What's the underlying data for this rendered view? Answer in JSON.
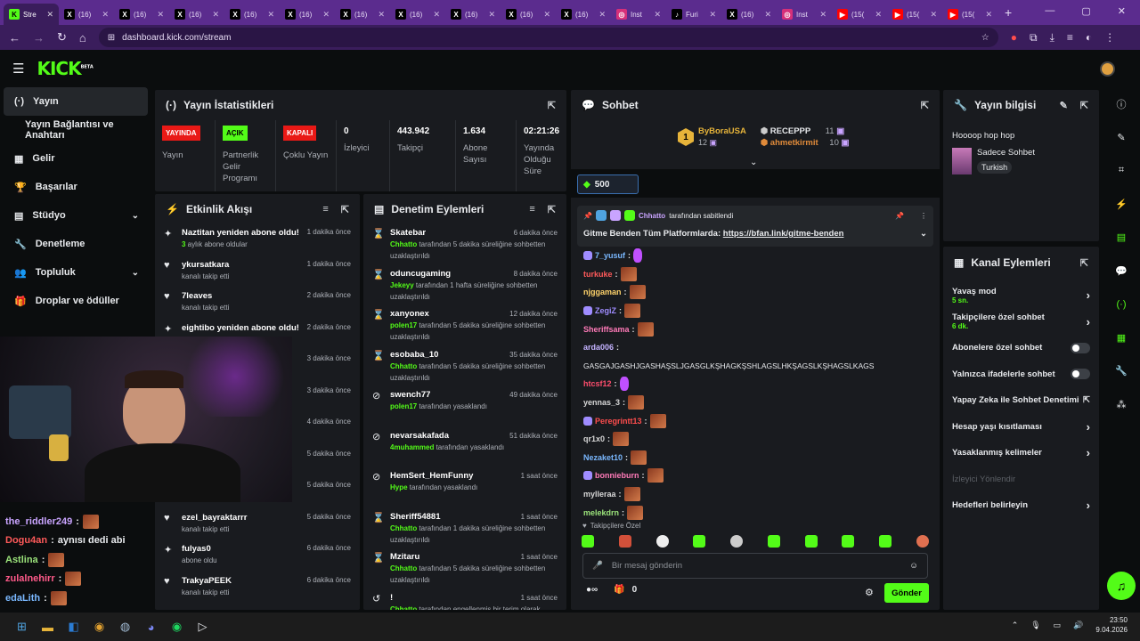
{
  "browser": {
    "tabs": [
      {
        "label": "Stre",
        "fav": "K",
        "color": "#53fc18",
        "active": true
      },
      {
        "label": "(16)",
        "fav": "X",
        "color": "#000000"
      },
      {
        "label": "(16)",
        "fav": "X",
        "color": "#000000"
      },
      {
        "label": "(16)",
        "fav": "X",
        "color": "#000000"
      },
      {
        "label": "(16)",
        "fav": "X",
        "color": "#000000"
      },
      {
        "label": "(16)",
        "fav": "X",
        "color": "#000000"
      },
      {
        "label": "(16)",
        "fav": "X",
        "color": "#000000"
      },
      {
        "label": "(16)",
        "fav": "X",
        "color": "#000000"
      },
      {
        "label": "(16)",
        "fav": "X",
        "color": "#000000"
      },
      {
        "label": "(16)",
        "fav": "X",
        "color": "#000000"
      },
      {
        "label": "(16)",
        "fav": "X",
        "color": "#000000"
      },
      {
        "label": "Inst",
        "fav": "◎",
        "color": "#d6307a"
      },
      {
        "label": "Furi",
        "fav": "♪",
        "color": "#000000"
      },
      {
        "label": "(16)",
        "fav": "X",
        "color": "#000000"
      },
      {
        "label": "Inst",
        "fav": "◎",
        "color": "#d6307a"
      },
      {
        "label": "(15(",
        "fav": "▶",
        "color": "#ff0000"
      },
      {
        "label": "(15(",
        "fav": "▶",
        "color": "#ff0000"
      },
      {
        "label": "(15(",
        "fav": "▶",
        "color": "#ff0000"
      }
    ],
    "url": "dashboard.kick.com/stream"
  },
  "sidebar": {
    "items": [
      {
        "label": "Yayın",
        "icon": "broadcast-icon",
        "glyph": "(·)"
      },
      {
        "label": "Yayın Bağlantısı ve Anahtarı"
      },
      {
        "label": "Gelir",
        "icon": "revenue-icon",
        "glyph": "▦"
      },
      {
        "label": "Başarılar",
        "icon": "trophy-icon",
        "glyph": "🏆"
      },
      {
        "label": "Stüdyo",
        "icon": "studio-icon",
        "glyph": "▤",
        "chev": "⌄"
      },
      {
        "label": "Denetleme",
        "icon": "wrench-icon",
        "glyph": "🔧"
      },
      {
        "label": "Topluluk",
        "icon": "community-icon",
        "glyph": "👥",
        "chev": "⌄"
      },
      {
        "label": "Droplar ve ödüller",
        "icon": "gift-icon",
        "glyph": "🎁"
      }
    ]
  },
  "stats": {
    "title": "Yayın İstatistikleri",
    "cols": [
      {
        "badge": "YAYINDA",
        "badge_color": "#e91916",
        "label": "Yayın"
      },
      {
        "badge": "AÇIK",
        "badge_color": "#53fc18",
        "label": "Partnerlik Gelir Programı"
      },
      {
        "badge": "KAPALI",
        "badge_color": "#e91916",
        "label": "Çoklu Yayın"
      },
      {
        "value": "0",
        "label": "İzleyici"
      },
      {
        "value": "443.942",
        "label": "Takipçi"
      },
      {
        "value": "1.634",
        "label": "Abone Sayısı"
      },
      {
        "value": "02:21:26",
        "label": "Yayında Olduğu Süre"
      }
    ]
  },
  "activity": {
    "title": "Etkinlik Akışı",
    "items": [
      {
        "icon": "sparkle-icon",
        "glyph": "✦",
        "name": "Naztitan yeniden abone oldu!",
        "sub_green": "3",
        "sub": " aylık abone oldular",
        "time": "1 dakika önce"
      },
      {
        "icon": "heart-icon",
        "glyph": "♥",
        "name": "ykursatkara",
        "sub": "kanalı takip etti",
        "time": "1 dakika önce"
      },
      {
        "icon": "heart-icon",
        "glyph": "♥",
        "name": "7leaves",
        "sub": "kanalı takip etti",
        "time": "2 dakika önce"
      },
      {
        "icon": "sparkle-icon",
        "glyph": "✦",
        "name": "eightibo yeniden abone oldu!",
        "sub": "",
        "time": "2 dakika önce"
      },
      {
        "icon": "heart-icon",
        "glyph": "♥",
        "name": "",
        "sub": "",
        "time": "3 dakika önce"
      },
      {
        "icon": "heart-icon",
        "glyph": "♥",
        "name": "",
        "sub": "",
        "time": "3 dakika önce"
      },
      {
        "icon": "heart-icon",
        "glyph": "♥",
        "name": "",
        "sub": "",
        "time": "4 dakika önce"
      },
      {
        "icon": "heart-icon",
        "glyph": "♥",
        "name": "",
        "sub": "",
        "time": "5 dakika önce"
      },
      {
        "icon": "heart-icon",
        "glyph": "♥",
        "name": "",
        "sub": "kanalı takip etti",
        "time": "5 dakika önce"
      },
      {
        "icon": "heart-icon",
        "glyph": "♥",
        "name": "ezel_bayraktarrr",
        "sub": "kanalı takip etti",
        "time": "5 dakika önce"
      },
      {
        "icon": "star-icon",
        "glyph": "✦",
        "name": "fulyas0",
        "sub": "abone oldu",
        "time": "6 dakika önce"
      },
      {
        "icon": "heart-icon",
        "glyph": "♥",
        "name": "TrakyaPEEK",
        "sub": "kanalı takip etti",
        "time": "6 dakika önce"
      }
    ]
  },
  "moderation": {
    "title": "Denetim Eylemleri",
    "items": [
      {
        "icon": "hourglass-icon",
        "glyph": "⌛",
        "name": "Skatebar",
        "actor": "Chhatto",
        "text": " tarafından 5 dakika süreliğine sohbetten uzaklaştırıldı",
        "time": "6 dakika önce"
      },
      {
        "icon": "hourglass-icon",
        "glyph": "⌛",
        "name": "oduncugaming",
        "actor": "Jekeyy",
        "text": " tarafından 1 hafta süreliğine sohbetten uzaklaştırıldı",
        "time": "8 dakika önce"
      },
      {
        "icon": "hourglass-icon",
        "glyph": "⌛",
        "name": "xanyonex",
        "actor": "polen17",
        "text": " tarafından 5 dakika süreliğine sohbetten uzaklaştırıldı",
        "time": "12 dakika önce"
      },
      {
        "icon": "hourglass-icon",
        "glyph": "⌛",
        "name": "esobaba_10",
        "actor": "Chhatto",
        "text": " tarafından 5 dakika süreliğine sohbetten uzaklaştırıldı",
        "time": "35 dakika önce"
      },
      {
        "icon": "ban-icon",
        "glyph": "⊘",
        "name": "swench77",
        "actor": "polen17",
        "text": " tarafından yasaklandı",
        "time": "49 dakika önce"
      },
      {
        "icon": "ban-icon",
        "glyph": "⊘",
        "name": "nevarsakafada",
        "actor": "4muhammed",
        "text": " tarafından yasaklandı",
        "time": "51 dakika önce"
      },
      {
        "icon": "ban-icon",
        "glyph": "⊘",
        "name": "HemSert_HemFunny",
        "actor": "Hype",
        "text": " tarafından yasaklandı",
        "time": "1 saat önce"
      },
      {
        "icon": "hourglass-icon",
        "glyph": "⌛",
        "name": "Sheriff54881",
        "actor": "Chhatto",
        "text": " tarafından 1 dakika süreliğine sohbetten uzaklaştırıldı",
        "time": "1 saat önce"
      },
      {
        "icon": "hourglass-icon",
        "glyph": "⌛",
        "name": "Mzitaru",
        "actor": "Chhatto",
        "text": " tarafından 5 dakika süreliğine sohbetten uzaklaştırıldı",
        "time": "1 saat önce"
      },
      {
        "icon": "undo-icon",
        "glyph": "↺",
        "name": "!",
        "actor": "Chhatto",
        "text": " tarafından engellenmiş bir terim olarak eklendi",
        "time": "1 saat önce"
      }
    ]
  },
  "chat": {
    "title": "Sohbet",
    "top": [
      {
        "rank": "1",
        "name": "ByBoraUSA",
        "count": "12"
      },
      {
        "name": "RECEPPP",
        "count": "11"
      },
      {
        "name": "ahmetkirmit",
        "count": "10"
      }
    ],
    "goal": "500",
    "pinned_by": "Chhatto",
    "pinned_suffix": " tarafından sabitlendi",
    "pinned_text": "Gitme Benden Tüm Platformlarda: ",
    "pinned_link": "https://bfan.link/gitme-benden",
    "messages": [
      {
        "user": "7_yusuf",
        "color": "#7ab8ff",
        "text": ""
      },
      {
        "user": "turkuke",
        "color": "#ff5a5a",
        "text": ""
      },
      {
        "user": "njggaman",
        "color": "#ffd36b",
        "text": ""
      },
      {
        "user": "ZegiZ",
        "color": "#9f8cff",
        "text": ""
      },
      {
        "user": "Sheriffsama",
        "color": "#ff7ab8",
        "text": ""
      },
      {
        "user": "arda006",
        "color": "#c4b3ff",
        "text": ""
      },
      {
        "user": "",
        "color": "#ffffff",
        "text": "GASGAJGASHJGASHAŞSLJGASGLKŞHAGKŞSHLAGSLHKŞAGSLKŞHAGSLKAGS"
      },
      {
        "user": "htcsf12",
        "color": "#ff4d6d",
        "text": ""
      },
      {
        "user": "yennas_3",
        "color": "#d7d7d7",
        "text": ""
      },
      {
        "user": "Peregrintt13",
        "color": "#ff4d4d",
        "text": ""
      },
      {
        "user": "qr1x0",
        "color": "#d7d7d7",
        "text": ""
      },
      {
        "user": "Nezaket10",
        "color": "#7ab8ff",
        "text": ""
      },
      {
        "user": "bonnieburn",
        "color": "#ff7ab8",
        "text": ""
      },
      {
        "user": "mylleraa",
        "color": "#d7d7d7",
        "text": ""
      },
      {
        "user": "melekdrn",
        "color": "#9be37b",
        "text": ""
      }
    ],
    "followers_only": "Takipçilere Özel",
    "input_placeholder": "Bir mesaj gönderin",
    "count": "0",
    "send_label": "Gönder"
  },
  "stream_info": {
    "title": "Yayın bilgisi",
    "stream_title": "Hoooop hop hop",
    "category": "Sadece Sohbet",
    "language": "Turkish"
  },
  "channel_actions": {
    "title": "Kanal Eylemleri",
    "items": [
      {
        "label": "Yavaş mod",
        "sub": "5 sn.",
        "ctl": "chevron"
      },
      {
        "label": "Takipçilere özel sohbet",
        "sub": "6 dk.",
        "ctl": "chevron"
      },
      {
        "label": "Abonelere özel sohbet",
        "ctl": "toggle"
      },
      {
        "label": "Yalnızca ifadelerle sohbet",
        "ctl": "toggle"
      },
      {
        "label": "Yapay Zeka ile Sohbet Denetimi",
        "ctl": "external"
      },
      {
        "label": "Hesap yaşı kısıtlaması",
        "ctl": "chevron"
      },
      {
        "label": "Yasaklanmış kelimeler",
        "ctl": "chevron"
      },
      {
        "label": "İzleyici Yönlendir",
        "ctl": "none",
        "dim": true
      },
      {
        "label": "Hedefleri belirleyin",
        "ctl": "chevron"
      }
    ]
  },
  "overlay_chat": [
    {
      "user": "the_riddler249",
      "color": "#c9a4ff",
      "text": ""
    },
    {
      "user": "Dogu4an",
      "color": "#ff5a5a",
      "text": "aynısı dedi abi"
    },
    {
      "user": "Astlina",
      "color": "#9be37b",
      "text": ""
    },
    {
      "user": "zulalnehirr",
      "color": "#ff5a8a",
      "text": ""
    },
    {
      "user": "edaLith",
      "color": "#7ab8ff",
      "text": ""
    }
  ],
  "taskbar": {
    "time": "23:50",
    "date": "9.04.2026"
  }
}
